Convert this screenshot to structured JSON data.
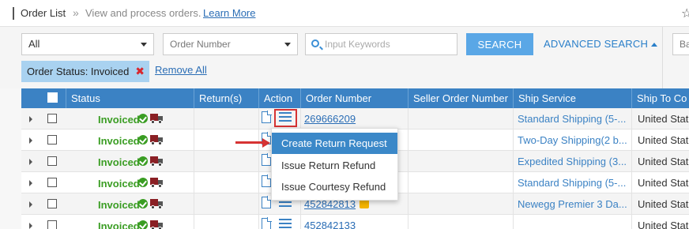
{
  "breadcrumb": {
    "title": "Order List",
    "separator": "»",
    "description": "View and process orders.",
    "learn_more": "Learn More"
  },
  "filters": {
    "status_select": "All",
    "field_select": "Order Number",
    "keyword_placeholder": "Input Keywords",
    "search_button": "SEARCH",
    "advanced_search": "ADVANCED SEARCH",
    "right_select_partial": "Ba",
    "active_chip": "Order Status: Invoiced",
    "chip_remove": "✖",
    "remove_all": "Remove All"
  },
  "table": {
    "headers": [
      "Status",
      "Return(s)",
      "Action",
      "Order Number",
      "Seller Order Number",
      "Ship Service",
      "Ship To Co"
    ],
    "rows": [
      {
        "status": "Invoiced",
        "order": "269666209",
        "ship": "Standard Shipping (5-...",
        "country": "United State"
      },
      {
        "status": "Invoiced",
        "order": "",
        "ship": "Two-Day Shipping(2 b...",
        "country": "United State"
      },
      {
        "status": "Invoiced",
        "order": "",
        "ship": "Expedited Shipping (3...",
        "country": "United State"
      },
      {
        "status": "Invoiced",
        "order": "",
        "ship": "Standard Shipping (5-...",
        "country": "United State"
      },
      {
        "status": "Invoiced",
        "order": "452842813",
        "ship": "Newegg Premier 3 Da...",
        "country": "United State"
      },
      {
        "status": "Invoiced",
        "order": "452842133",
        "ship": "",
        "country": "United State"
      }
    ]
  },
  "action_menu": {
    "items": [
      "Create Return Request",
      "Issue Return Refund",
      "Issue Courtesy Refund"
    ],
    "active_index": 0
  },
  "colors": {
    "header_blue": "#3b82c4",
    "status_green": "#3a9d23",
    "chip_bg": "#a9d2f0",
    "highlight_red": "#d63333"
  },
  "icons": {
    "star": "star-icon",
    "search": "search-icon",
    "document": "document-icon",
    "list": "list-icon",
    "truck": "truck-icon",
    "check": "check-circle-icon",
    "expand": "expand-triangle-icon"
  }
}
